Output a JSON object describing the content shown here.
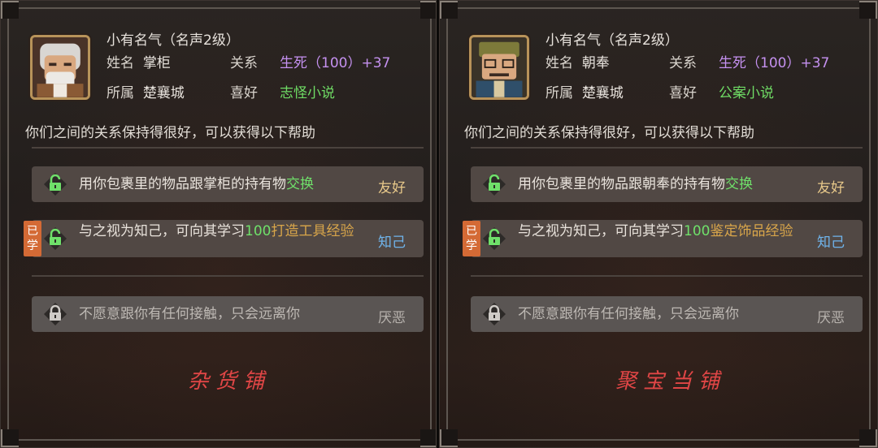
{
  "panels": [
    {
      "title": "小有名气（名声2级）",
      "name_label": "姓名",
      "name": "掌柜",
      "relation_label": "关系",
      "relation_value": "生死（100）",
      "relation_bonus": "+37",
      "faction_label": "所属",
      "faction": "楚襄城",
      "hobby_label": "喜好",
      "hobby": "志怪小说",
      "description": "你们之间的关系保持得很好，可以获得以下帮助",
      "abilities": [
        {
          "text_pre": "用你包裹里的物品跟掌柜的持有物",
          "text_hl": "交换",
          "tier": "友好"
        },
        {
          "badge": "已学",
          "text_pre": "与之视为知己，可向其学习",
          "text_hl": "100",
          "text_gold": "打造工具经验",
          "tier": "知己"
        },
        {
          "text_pre": "不愿意跟你有任何接触，只会远离你",
          "tier": "厌恶"
        }
      ],
      "shop_name": "杂货铺"
    },
    {
      "title": "小有名气（名声2级）",
      "name_label": "姓名",
      "name": "朝奉",
      "relation_label": "关系",
      "relation_value": "生死（100）",
      "relation_bonus": "+37",
      "faction_label": "所属",
      "faction": "楚襄城",
      "hobby_label": "喜好",
      "hobby": "公案小说",
      "description": "你们之间的关系保持得很好，可以获得以下帮助",
      "abilities": [
        {
          "text_pre": "用你包裹里的物品跟朝奉的持有物",
          "text_hl": "交换",
          "tier": "友好"
        },
        {
          "badge": "已学",
          "text_pre": "与之视为知己，可向其学习",
          "text_hl": "100",
          "text_gold": "鉴定饰品经验",
          "tier": "知己"
        },
        {
          "text_pre": "不愿意跟你有任何接触，只会远离你",
          "tier": "厌恶"
        }
      ],
      "shop_name": "聚宝当铺"
    }
  ],
  "colors": {
    "relation": "#c591f0",
    "hobby": "#6fdc65",
    "highlight": "#6fe06a",
    "gold": "#d9a64a",
    "friend": "#e8c98a",
    "bosom": "#6fb4ec",
    "shop": "#e04646",
    "badge": "#d46a35"
  },
  "icons": {
    "lock_open": "lock-open-icon",
    "lock_closed": "lock-closed-icon"
  }
}
